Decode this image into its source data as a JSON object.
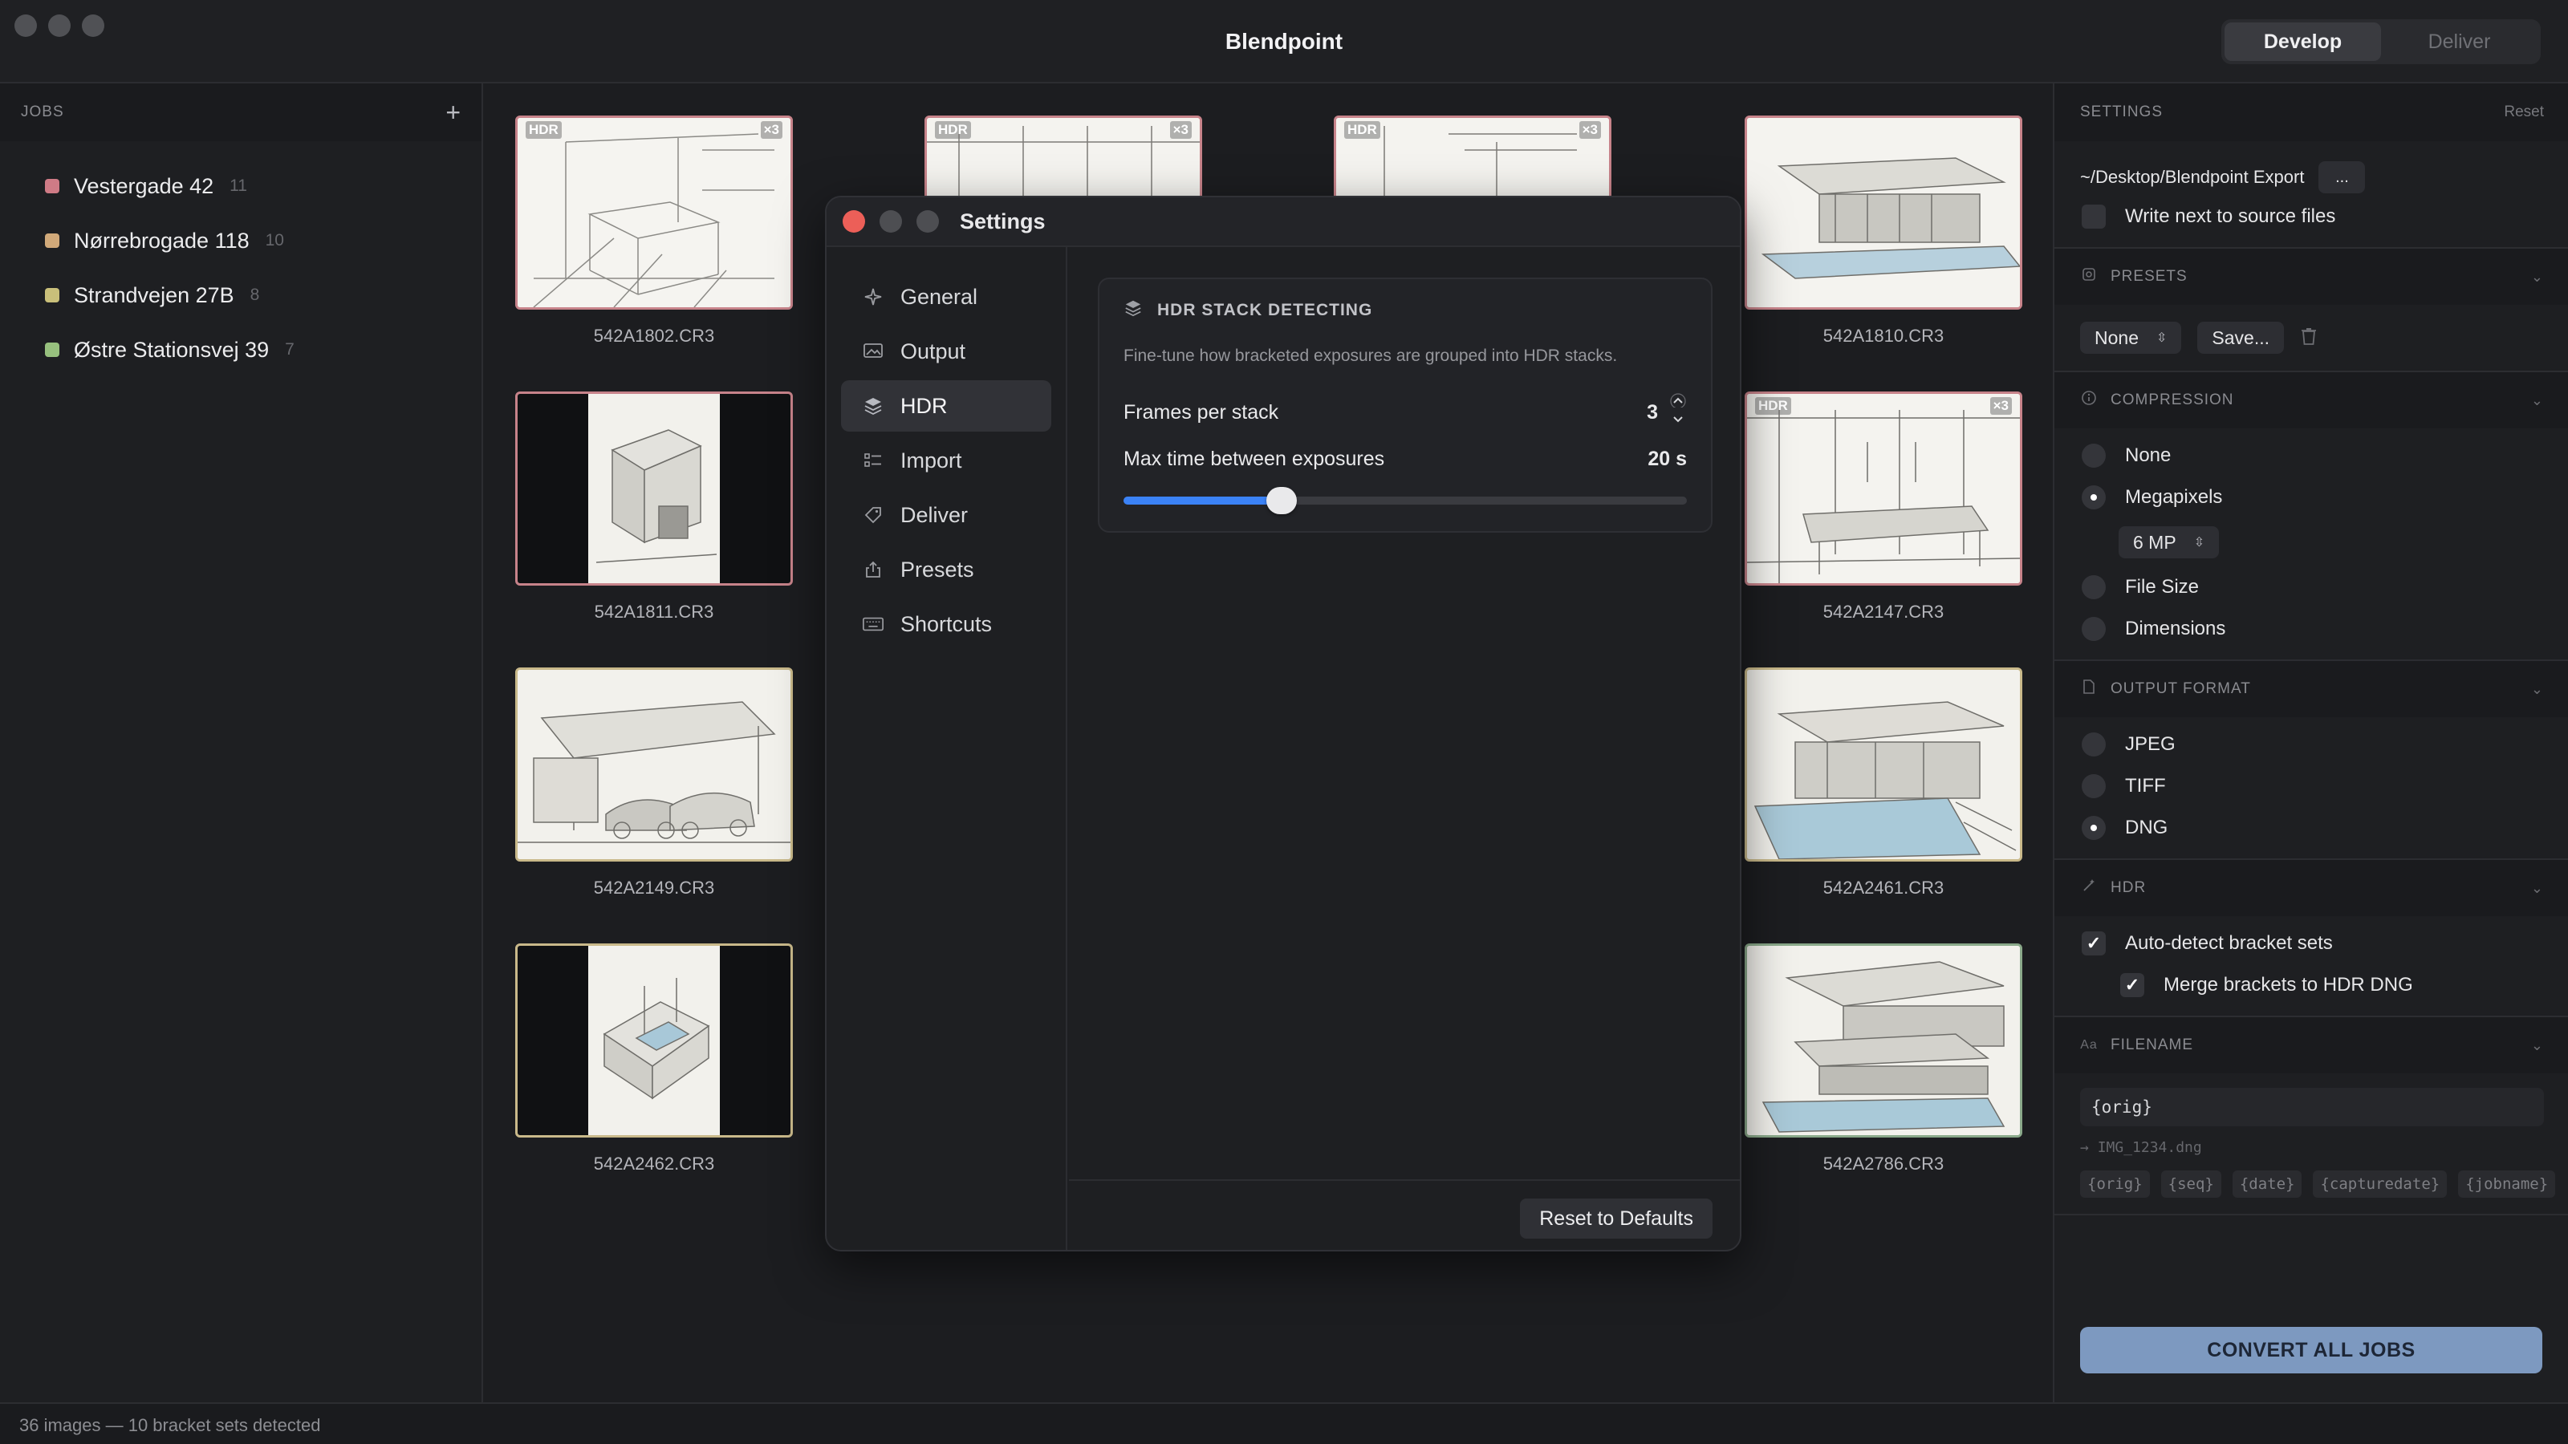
{
  "app": {
    "title": "Blendpoint",
    "modes": [
      "Develop",
      "Deliver"
    ],
    "active_mode": "Develop"
  },
  "jobs": {
    "header": "JOBS",
    "add_symbol": "+",
    "items": [
      {
        "name": "Vestergade 42",
        "count": "11",
        "color": "#cf7b86"
      },
      {
        "name": "Nørrebrogade 118",
        "count": "10",
        "color": "#d1a97a"
      },
      {
        "name": "Strandvejen 27B",
        "count": "8",
        "color": "#c9bf7a"
      },
      {
        "name": "Østre Stationsvej 39",
        "count": "7",
        "color": "#97c07e"
      }
    ]
  },
  "grid": {
    "thumbs": [
      {
        "file": "542A1802.CR3",
        "hdr": "HDR",
        "stack": "×3"
      },
      {
        "file": "542A1811.CR3"
      },
      {
        "file": "542A2149.CR3"
      },
      {
        "file": "542A2462.CR3"
      },
      {
        "file": "",
        "hdr": "HDR",
        "stack": "×3"
      },
      {
        "file": "",
        "hdr": "HDR",
        "stack": "×3"
      },
      {
        "file": "542A1810.CR3"
      },
      {
        "file": "542A2147.CR3",
        "hdr": "HDR",
        "stack": "×3"
      },
      {
        "file": "542A2461.CR3"
      },
      {
        "file": "542A2786.CR3"
      }
    ]
  },
  "settings_window": {
    "title": "Settings",
    "nav": [
      {
        "label": "General",
        "icon": "sparkle-icon"
      },
      {
        "label": "Output",
        "icon": "image-output-icon"
      },
      {
        "label": "HDR",
        "icon": "layers-icon",
        "active": true
      },
      {
        "label": "Import",
        "icon": "checklist-icon"
      },
      {
        "label": "Deliver",
        "icon": "tag-icon"
      },
      {
        "label": "Presets",
        "icon": "share-icon"
      },
      {
        "label": "Shortcuts",
        "icon": "keyboard-icon"
      }
    ],
    "hdr_card": {
      "title": "HDR STACK DETECTING",
      "description": "Fine-tune how bracketed exposures are grouped into HDR stacks.",
      "frames_label": "Frames per stack",
      "frames_value": "3",
      "max_time_label": "Max time between exposures",
      "max_time_value": "20 s",
      "max_time_fraction": 0.28
    },
    "reset_button": "Reset to Defaults"
  },
  "panel": {
    "header": "SETTINGS",
    "reset": "Reset",
    "export_path": "~/Desktop/Blendpoint Export",
    "browse_button": "...",
    "write_next_to_source": "Write next to source files",
    "presets": {
      "title": "PRESETS",
      "selected": "None",
      "save": "Save..."
    },
    "compression": {
      "title": "COMPRESSION",
      "options": [
        "None",
        "Megapixels",
        "File Size",
        "Dimensions"
      ],
      "selected": "Megapixels",
      "megapixels_value": "6 MP"
    },
    "output_format": {
      "title": "OUTPUT FORMAT",
      "options": [
        "JPEG",
        "TIFF",
        "DNG"
      ],
      "selected": "DNG"
    },
    "hdr": {
      "title": "HDR",
      "auto_detect": "Auto-detect bracket sets",
      "merge": "Merge brackets to HDR DNG"
    },
    "filename": {
      "title": "FILENAME",
      "pattern": "{orig}",
      "preview_arrow": "→",
      "preview": "IMG_1234.dng",
      "tokens": [
        "{orig}",
        "{seq}",
        "{date}",
        "{capturedate}",
        "{jobname}"
      ]
    },
    "convert_button": "CONVERT ALL JOBS"
  },
  "status": {
    "text": "36 images — 10 bracket sets detected"
  },
  "colors": {
    "accent": "#3b82f6",
    "close_red": "#ec5f58",
    "convert_button": "#7d99c0"
  }
}
